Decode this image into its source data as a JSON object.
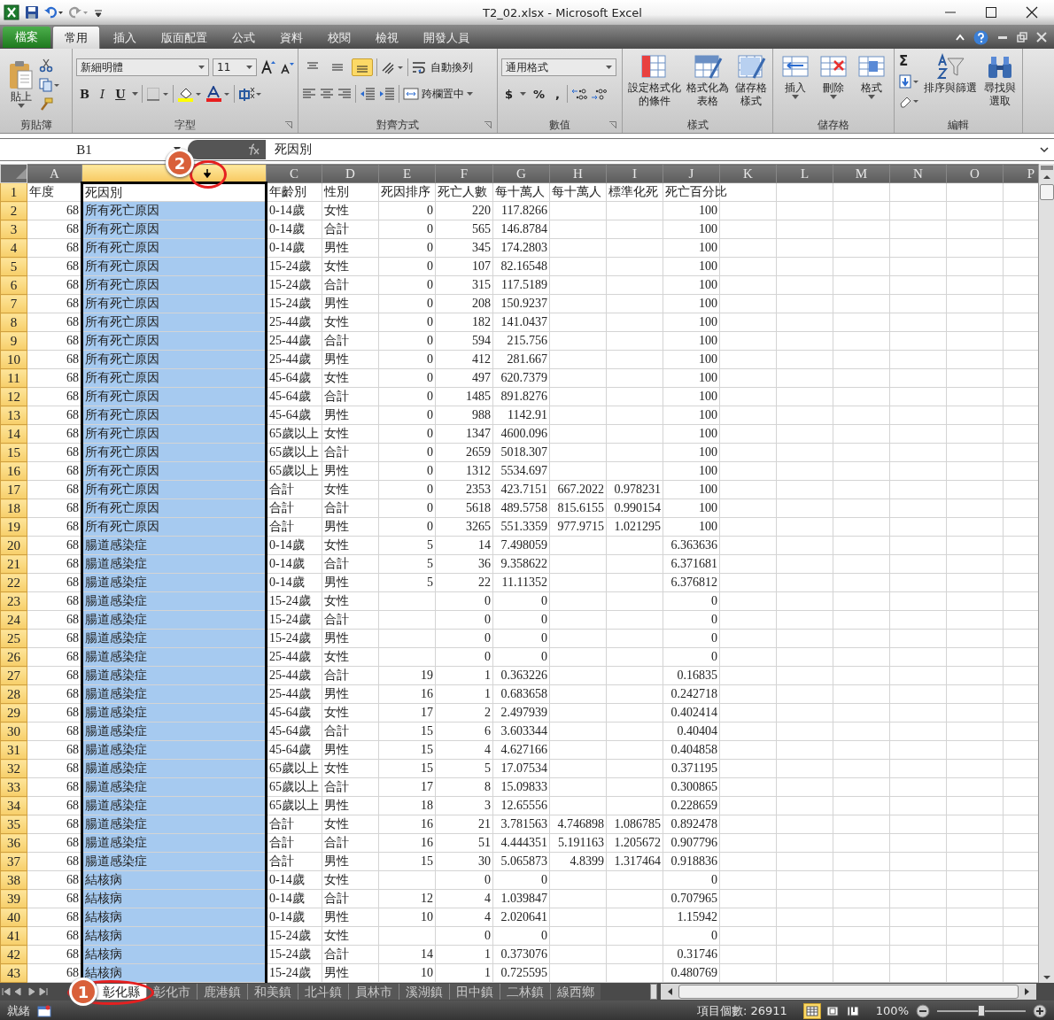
{
  "window": {
    "title": "T2_02.xlsx - Microsoft Excel"
  },
  "ribbon_tabs": [
    {
      "label": "檔案",
      "kind": "file",
      "selected": false
    },
    {
      "label": "常用",
      "kind": "tab",
      "selected": true
    },
    {
      "label": "插入",
      "kind": "tab",
      "selected": false
    },
    {
      "label": "版面配置",
      "kind": "tab",
      "selected": false
    },
    {
      "label": "公式",
      "kind": "tab",
      "selected": false
    },
    {
      "label": "資料",
      "kind": "tab",
      "selected": false
    },
    {
      "label": "校閱",
      "kind": "tab",
      "selected": false
    },
    {
      "label": "檢視",
      "kind": "tab",
      "selected": false
    },
    {
      "label": "開發人員",
      "kind": "tab",
      "selected": false
    }
  ],
  "ribbon": {
    "clipboard": {
      "label": "剪貼簿",
      "paste": "貼上"
    },
    "font": {
      "label": "字型",
      "name": "新細明體",
      "size": "11",
      "bold": "B",
      "italic": "I",
      "underline": "U"
    },
    "alignment": {
      "label": "對齊方式",
      "wrap": "自動換列",
      "merge": "跨欄置中",
      "vertical_align": [
        {
          "selected": false
        },
        {
          "selected": false
        },
        {
          "selected": true
        }
      ]
    },
    "number": {
      "label": "數值",
      "format": "通用格式",
      "currency": "$",
      "percent": "%",
      "comma": ","
    },
    "styles": {
      "label": "樣式",
      "buttons": [
        {
          "lines": [
            "設定格式化",
            "的條件"
          ]
        },
        {
          "lines": [
            "格式化為",
            "表格"
          ]
        },
        {
          "lines": [
            "儲存格",
            "樣式"
          ]
        }
      ]
    },
    "cells": {
      "label": "儲存格",
      "buttons": [
        "插入",
        "刪除",
        "格式"
      ]
    },
    "editing": {
      "label": "編輯",
      "sigma": "Σ",
      "buttons": [
        {
          "lines": [
            "排序與篩選"
          ]
        },
        {
          "lines": [
            "尋找與",
            "選取"
          ]
        }
      ]
    }
  },
  "formula_bar": {
    "name_box": "B1",
    "value": "死因別"
  },
  "sheet": {
    "columns": [
      {
        "label": "A",
        "kind": "number",
        "selected": false
      },
      {
        "kind": "text",
        "selected": true
      },
      {
        "label": "C",
        "kind": "text",
        "selected": false
      },
      {
        "label": "D",
        "kind": "text",
        "selected": false
      },
      {
        "label": "E",
        "kind": "number",
        "selected": false
      },
      {
        "label": "F",
        "kind": "number",
        "selected": false
      },
      {
        "label": "G",
        "kind": "number",
        "selected": false
      },
      {
        "label": "H",
        "kind": "number",
        "selected": false
      },
      {
        "label": "I",
        "kind": "number",
        "selected": false
      },
      {
        "label": "J",
        "kind": "number",
        "selected": false
      },
      {
        "label": "K",
        "kind": "text",
        "selected": false
      },
      {
        "label": "L",
        "kind": "text",
        "selected": false
      },
      {
        "label": "M",
        "kind": "text",
        "selected": false
      },
      {
        "label": "N",
        "kind": "text",
        "selected": false
      },
      {
        "label": "O",
        "kind": "text",
        "selected": false
      },
      {
        "label": "P",
        "kind": "text",
        "selected": false
      }
    ],
    "header_row": {
      "header": "1",
      "selected": true,
      "active": true,
      "cells": [
        "年度",
        "死因別",
        "年齡別",
        "性別",
        "死因排序",
        "死亡人數",
        "每十萬人",
        "每十萬人",
        "標準化死",
        "死亡百分比"
      ]
    },
    "rows": [
      {
        "header": "2",
        "selected": true,
        "active": false,
        "cells": [
          "68",
          "所有死亡原因",
          "0-14歲",
          "女性",
          "0",
          "220",
          "117.8266",
          null,
          null,
          "100"
        ]
      },
      {
        "header": "3",
        "selected": true,
        "active": false,
        "cells": [
          "68",
          "所有死亡原因",
          "0-14歲",
          "合計",
          "0",
          "565",
          "146.8784",
          null,
          null,
          "100"
        ]
      },
      {
        "header": "4",
        "selected": true,
        "active": false,
        "cells": [
          "68",
          "所有死亡原因",
          "0-14歲",
          "男性",
          "0",
          "345",
          "174.2803",
          null,
          null,
          "100"
        ]
      },
      {
        "header": "5",
        "selected": true,
        "active": false,
        "cells": [
          "68",
          "所有死亡原因",
          "15-24歲",
          "女性",
          "0",
          "107",
          "82.16548",
          null,
          null,
          "100"
        ]
      },
      {
        "header": "6",
        "selected": true,
        "active": false,
        "cells": [
          "68",
          "所有死亡原因",
          "15-24歲",
          "合計",
          "0",
          "315",
          "117.5189",
          null,
          null,
          "100"
        ]
      },
      {
        "header": "7",
        "selected": true,
        "active": false,
        "cells": [
          "68",
          "所有死亡原因",
          "15-24歲",
          "男性",
          "0",
          "208",
          "150.9237",
          null,
          null,
          "100"
        ]
      },
      {
        "header": "8",
        "selected": true,
        "active": false,
        "cells": [
          "68",
          "所有死亡原因",
          "25-44歲",
          "女性",
          "0",
          "182",
          "141.0437",
          null,
          null,
          "100"
        ]
      },
      {
        "header": "9",
        "selected": true,
        "active": false,
        "cells": [
          "68",
          "所有死亡原因",
          "25-44歲",
          "合計",
          "0",
          "594",
          "215.756",
          null,
          null,
          "100"
        ]
      },
      {
        "header": "10",
        "selected": true,
        "active": false,
        "cells": [
          "68",
          "所有死亡原因",
          "25-44歲",
          "男性",
          "0",
          "412",
          "281.667",
          null,
          null,
          "100"
        ]
      },
      {
        "header": "11",
        "selected": true,
        "active": false,
        "cells": [
          "68",
          "所有死亡原因",
          "45-64歲",
          "女性",
          "0",
          "497",
          "620.7379",
          null,
          null,
          "100"
        ]
      },
      {
        "header": "12",
        "selected": true,
        "active": false,
        "cells": [
          "68",
          "所有死亡原因",
          "45-64歲",
          "合計",
          "0",
          "1485",
          "891.8276",
          null,
          null,
          "100"
        ]
      },
      {
        "header": "13",
        "selected": true,
        "active": false,
        "cells": [
          "68",
          "所有死亡原因",
          "45-64歲",
          "男性",
          "0",
          "988",
          "1142.91",
          null,
          null,
          "100"
        ]
      },
      {
        "header": "14",
        "selected": true,
        "active": false,
        "cells": [
          "68",
          "所有死亡原因",
          "65歲以上",
          "女性",
          "0",
          "1347",
          "4600.096",
          null,
          null,
          "100"
        ]
      },
      {
        "header": "15",
        "selected": true,
        "active": false,
        "cells": [
          "68",
          "所有死亡原因",
          "65歲以上",
          "合計",
          "0",
          "2659",
          "5018.307",
          null,
          null,
          "100"
        ]
      },
      {
        "header": "16",
        "selected": true,
        "active": false,
        "cells": [
          "68",
          "所有死亡原因",
          "65歲以上",
          "男性",
          "0",
          "1312",
          "5534.697",
          null,
          null,
          "100"
        ]
      },
      {
        "header": "17",
        "selected": true,
        "active": false,
        "cells": [
          "68",
          "所有死亡原因",
          "合計",
          "女性",
          "0",
          "2353",
          "423.7151",
          "667.2022",
          "0.978231",
          "100"
        ]
      },
      {
        "header": "18",
        "selected": true,
        "active": false,
        "cells": [
          "68",
          "所有死亡原因",
          "合計",
          "合計",
          "0",
          "5618",
          "489.5758",
          "815.6155",
          "0.990154",
          "100"
        ]
      },
      {
        "header": "19",
        "selected": true,
        "active": false,
        "cells": [
          "68",
          "所有死亡原因",
          "合計",
          "男性",
          "0",
          "3265",
          "551.3359",
          "977.9715",
          "1.021295",
          "100"
        ]
      },
      {
        "header": "20",
        "selected": true,
        "active": false,
        "cells": [
          "68",
          "腸道感染症",
          "0-14歲",
          "女性",
          "5",
          "14",
          "7.498059",
          null,
          null,
          "6.363636"
        ]
      },
      {
        "header": "21",
        "selected": true,
        "active": false,
        "cells": [
          "68",
          "腸道感染症",
          "0-14歲",
          "合計",
          "5",
          "36",
          "9.358622",
          null,
          null,
          "6.371681"
        ]
      },
      {
        "header": "22",
        "selected": true,
        "active": false,
        "cells": [
          "68",
          "腸道感染症",
          "0-14歲",
          "男性",
          "5",
          "22",
          "11.11352",
          null,
          null,
          "6.376812"
        ]
      },
      {
        "header": "23",
        "selected": true,
        "active": false,
        "cells": [
          "68",
          "腸道感染症",
          "15-24歲",
          "女性",
          null,
          "0",
          "0",
          null,
          null,
          "0"
        ]
      },
      {
        "header": "24",
        "selected": true,
        "active": false,
        "cells": [
          "68",
          "腸道感染症",
          "15-24歲",
          "合計",
          null,
          "0",
          "0",
          null,
          null,
          "0"
        ]
      },
      {
        "header": "25",
        "selected": true,
        "active": false,
        "cells": [
          "68",
          "腸道感染症",
          "15-24歲",
          "男性",
          null,
          "0",
          "0",
          null,
          null,
          "0"
        ]
      },
      {
        "header": "26",
        "selected": true,
        "active": false,
        "cells": [
          "68",
          "腸道感染症",
          "25-44歲",
          "女性",
          null,
          "0",
          "0",
          null,
          null,
          "0"
        ]
      },
      {
        "header": "27",
        "selected": true,
        "active": false,
        "cells": [
          "68",
          "腸道感染症",
          "25-44歲",
          "合計",
          "19",
          "1",
          "0.363226",
          null,
          null,
          "0.16835"
        ]
      },
      {
        "header": "28",
        "selected": true,
        "active": false,
        "cells": [
          "68",
          "腸道感染症",
          "25-44歲",
          "男性",
          "16",
          "1",
          "0.683658",
          null,
          null,
          "0.242718"
        ]
      },
      {
        "header": "29",
        "selected": true,
        "active": false,
        "cells": [
          "68",
          "腸道感染症",
          "45-64歲",
          "女性",
          "17",
          "2",
          "2.497939",
          null,
          null,
          "0.402414"
        ]
      },
      {
        "header": "30",
        "selected": true,
        "active": false,
        "cells": [
          "68",
          "腸道感染症",
          "45-64歲",
          "合計",
          "15",
          "6",
          "3.603344",
          null,
          null,
          "0.40404"
        ]
      },
      {
        "header": "31",
        "selected": true,
        "active": false,
        "cells": [
          "68",
          "腸道感染症",
          "45-64歲",
          "男性",
          "15",
          "4",
          "4.627166",
          null,
          null,
          "0.404858"
        ]
      },
      {
        "header": "32",
        "selected": true,
        "active": false,
        "cells": [
          "68",
          "腸道感染症",
          "65歲以上",
          "女性",
          "15",
          "5",
          "17.07534",
          null,
          null,
          "0.371195"
        ]
      },
      {
        "header": "33",
        "selected": true,
        "active": false,
        "cells": [
          "68",
          "腸道感染症",
          "65歲以上",
          "合計",
          "17",
          "8",
          "15.09833",
          null,
          null,
          "0.300865"
        ]
      },
      {
        "header": "34",
        "selected": true,
        "active": false,
        "cells": [
          "68",
          "腸道感染症",
          "65歲以上",
          "男性",
          "18",
          "3",
          "12.65556",
          null,
          null,
          "0.228659"
        ]
      },
      {
        "header": "35",
        "selected": true,
        "active": false,
        "cells": [
          "68",
          "腸道感染症",
          "合計",
          "女性",
          "16",
          "21",
          "3.781563",
          "4.746898",
          "1.086785",
          "0.892478"
        ]
      },
      {
        "header": "36",
        "selected": true,
        "active": false,
        "cells": [
          "68",
          "腸道感染症",
          "合計",
          "合計",
          "16",
          "51",
          "4.444351",
          "5.191163",
          "1.205672",
          "0.907796"
        ]
      },
      {
        "header": "37",
        "selected": true,
        "active": false,
        "cells": [
          "68",
          "腸道感染症",
          "合計",
          "男性",
          "15",
          "30",
          "5.065873",
          "4.8399",
          "1.317464",
          "0.918836"
        ]
      },
      {
        "header": "38",
        "selected": true,
        "active": false,
        "cells": [
          "68",
          "結核病",
          "0-14歲",
          "女性",
          null,
          "0",
          "0",
          null,
          null,
          "0"
        ]
      },
      {
        "header": "39",
        "selected": true,
        "active": false,
        "cells": [
          "68",
          "結核病",
          "0-14歲",
          "合計",
          "12",
          "4",
          "1.039847",
          null,
          null,
          "0.707965"
        ]
      },
      {
        "header": "40",
        "selected": true,
        "active": false,
        "cells": [
          "68",
          "結核病",
          "0-14歲",
          "男性",
          "10",
          "4",
          "2.020641",
          null,
          null,
          "1.15942"
        ]
      },
      {
        "header": "41",
        "selected": true,
        "active": false,
        "cells": [
          "68",
          "結核病",
          "15-24歲",
          "女性",
          null,
          "0",
          "0",
          null,
          null,
          "0"
        ]
      },
      {
        "header": "42",
        "selected": true,
        "active": false,
        "cells": [
          "68",
          "結核病",
          "15-24歲",
          "合計",
          "14",
          "1",
          "0.373076",
          null,
          null,
          "0.31746"
        ]
      },
      {
        "header": "43",
        "selected": true,
        "active": false,
        "cells": [
          "68",
          "結核病",
          "15-24歲",
          "男性",
          "10",
          "1",
          "0.725595",
          null,
          null,
          "0.480769"
        ]
      }
    ]
  },
  "sheet_tabs": [
    {
      "label": "彰化縣",
      "selected": true
    },
    {
      "label": "彰化市",
      "selected": false
    },
    {
      "label": "鹿港鎮",
      "selected": false
    },
    {
      "label": "和美鎮",
      "selected": false
    },
    {
      "label": "北斗鎮",
      "selected": false
    },
    {
      "label": "員林市",
      "selected": false
    },
    {
      "label": "溪湖鎮",
      "selected": false
    },
    {
      "label": "田中鎮",
      "selected": false
    },
    {
      "label": "二林鎮",
      "selected": false
    },
    {
      "label": "線西鄉",
      "selected": false
    }
  ],
  "status_bar": {
    "status": "就緒",
    "count": "項目個數: 26911",
    "views": [
      {
        "selected": true
      },
      {
        "selected": false
      },
      {
        "selected": false
      }
    ],
    "zoom": "100%",
    "zoom_slider": {
      "level": 0.5
    }
  },
  "callouts": [
    {
      "number": "1"
    },
    {
      "number": "2"
    }
  ]
}
